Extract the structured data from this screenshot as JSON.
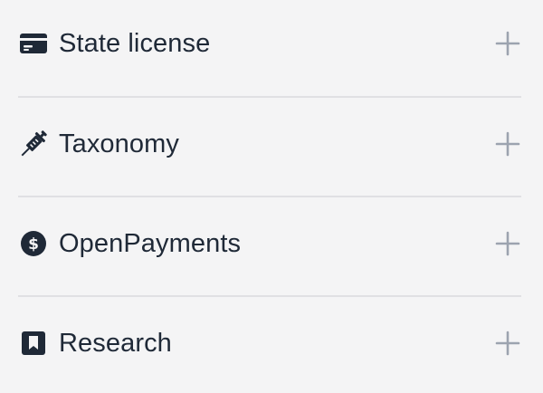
{
  "colors": {
    "background": "#f4f4f5",
    "text": "#1f2937",
    "icon": "#1f2937",
    "plus": "#9ca3af",
    "divider": "#e0e0e3"
  },
  "sections": [
    {
      "label": "State license",
      "icon": "credit-card-icon",
      "action_icon": "plus-icon"
    },
    {
      "label": "Taxonomy",
      "icon": "syringe-icon",
      "action_icon": "plus-icon"
    },
    {
      "label": "OpenPayments",
      "icon": "dollar-circle-icon",
      "action_icon": "plus-icon"
    },
    {
      "label": "Research",
      "icon": "bookmark-icon",
      "action_icon": "plus-icon"
    }
  ]
}
